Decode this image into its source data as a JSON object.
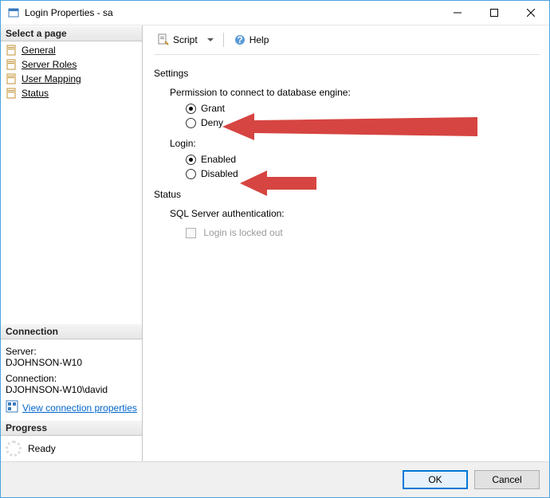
{
  "window": {
    "title": "Login Properties - sa"
  },
  "sidebar": {
    "select_page_label": "Select a page",
    "pages": [
      {
        "label": "General"
      },
      {
        "label": "Server Roles"
      },
      {
        "label": "User Mapping"
      },
      {
        "label": "Status"
      }
    ],
    "connection_label": "Connection",
    "server_key": "Server:",
    "server_value": "DJOHNSON-W10",
    "connection_key": "Connection:",
    "connection_value": "DJOHNSON-W10\\david",
    "view_conn_link": "View connection properties",
    "progress_label": "Progress",
    "progress_status": "Ready"
  },
  "toolbar": {
    "script_label": "Script",
    "help_label": "Help"
  },
  "content": {
    "settings_label": "Settings",
    "permission_label": "Permission to connect to database engine:",
    "grant_label": "Grant",
    "deny_label": "Deny",
    "login_label": "Login:",
    "enabled_label": "Enabled",
    "disabled_label": "Disabled",
    "status_label": "Status",
    "sql_auth_label": "SQL Server authentication:",
    "locked_out_label": "Login is locked out"
  },
  "buttons": {
    "ok": "OK",
    "cancel": "Cancel"
  }
}
